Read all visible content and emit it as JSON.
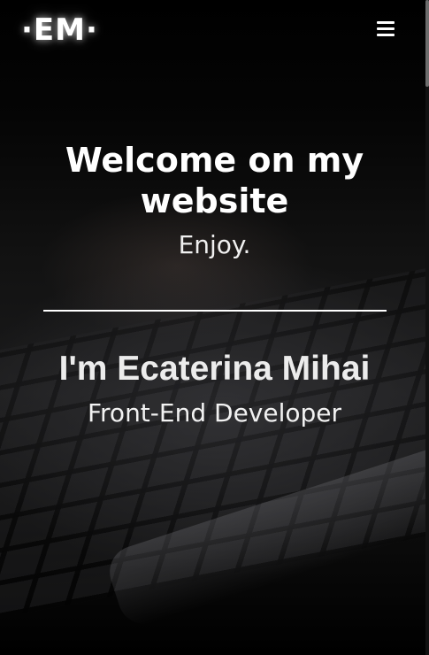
{
  "header": {
    "logo": "·EM·",
    "menu_icon": "hamburger-menu-icon"
  },
  "hero": {
    "title": "Welcome on my website",
    "subtitle": "Enjoy."
  },
  "intro": {
    "name": "I'm Ecaterina Mihai",
    "role": "Front-End Developer"
  },
  "colors": {
    "background": "#000000",
    "text": "#ffffff",
    "divider": "#ffffff"
  }
}
